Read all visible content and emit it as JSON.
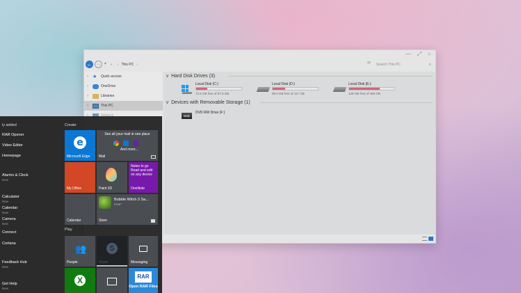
{
  "explorer": {
    "breadcrumb": "This PC",
    "search_placeholder": "Search This PC",
    "nav_items": [
      {
        "label": "Quick access"
      },
      {
        "label": "OneDrive"
      },
      {
        "label": "Libraries"
      },
      {
        "label": "This PC"
      },
      {
        "label": "Network"
      }
    ],
    "groups": {
      "hdd_title": "Hard Disk Drives (3)",
      "removable_title": "Devices with Removable Storage (1)"
    },
    "drives": [
      {
        "name": "Local Disk (C:)",
        "free_text": "72.8 GB free of 97.6 GB",
        "used_fraction": 0.25
      },
      {
        "name": "Local Disk (D:)",
        "free_text": "85.0 GB free of 117 GB",
        "used_fraction": 0.27
      },
      {
        "name": "Local Disk (E:)",
        "free_text": "149 GB free of 465 GB",
        "used_fraction": 0.68
      }
    ],
    "removable": [
      {
        "name": "DVD RW Drive (F:)",
        "icon_text": "DVD"
      }
    ]
  },
  "start_menu": {
    "section_recent": "ly added",
    "apps": [
      {
        "label": "RAR Opener",
        "sub": ""
      },
      {
        "label": "Video Editor",
        "sub": ""
      },
      {
        "label": "Homepage",
        "sub": ""
      },
      {
        "label": "Alarms & Clock",
        "sub": "New"
      },
      {
        "label": "Calculator",
        "sub": "New"
      },
      {
        "label": "Calendar",
        "sub": "New"
      },
      {
        "label": "Camera",
        "sub": "New"
      },
      {
        "label": "Connect",
        "sub": ""
      },
      {
        "label": "Cortana",
        "sub": ""
      },
      {
        "label": "Feedback Hub",
        "sub": "New"
      },
      {
        "label": "Get Help",
        "sub": "New"
      }
    ],
    "group_create": "Create",
    "group_play": "Play",
    "tiles": {
      "edge": "Microsoft Edge",
      "mail_top": "See all your mail in one place",
      "mail_more": "And more...",
      "mail": "Mail",
      "myoffice": "My Office",
      "paint3d": "Paint 3D",
      "onenote_text": "Notes to go Read and edit on any device",
      "onenote": "OneNote",
      "calendar": "Calendar",
      "bubble_title": "Bubble Witch 3 Sa...",
      "bubble_sub": "Free*",
      "store": "Store",
      "people": "People",
      "skype": "Skype",
      "messaging": "Messaging",
      "rar_box": "RAR",
      "rar_label": "Open RAR Files"
    }
  },
  "colors": {
    "accent_blue": "#0a78d4",
    "drive_fill": "#d0667a",
    "office_orange": "#d24726",
    "onenote_purple": "#7719aa",
    "xbox_green": "#107c10"
  }
}
